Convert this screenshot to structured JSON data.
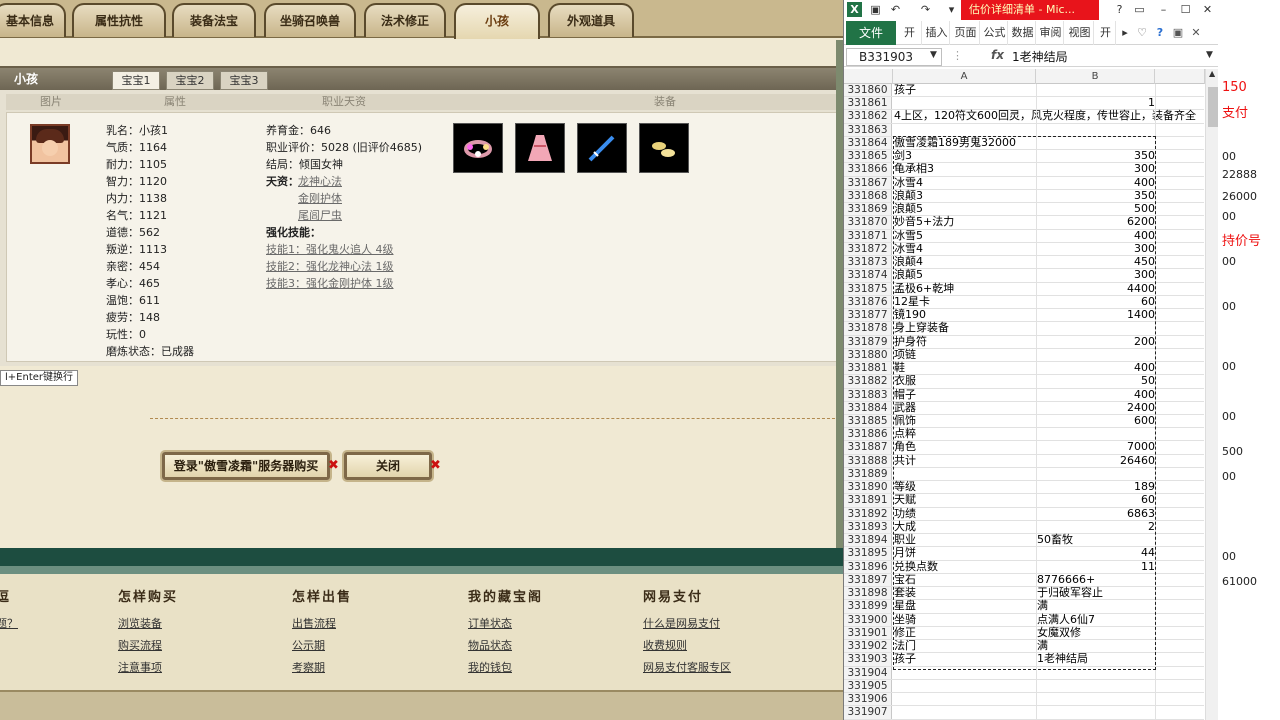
{
  "game": {
    "tabs": [
      "基本信息",
      "属性抗性",
      "装备法宝",
      "坐骑召唤兽",
      "法术修正",
      "小孩",
      "外观道具"
    ],
    "panel_title": "小孩",
    "baby_tabs": [
      "宝宝1",
      "宝宝2",
      "宝宝3"
    ],
    "col_headers": [
      "图片",
      "属性",
      "职业天资",
      "装备"
    ],
    "attrs": [
      "乳名：小孩1",
      "气质：1164",
      "耐力：1105",
      "智力：1120",
      "内力：1138",
      "名气：1121",
      "道德：562",
      "叛逆：1113",
      "亲密：454",
      "孝心：465",
      "温饱：611",
      "疲劳：148",
      "玩性：0",
      "磨炼状态：已成器"
    ],
    "career": {
      "fee": "养育金：646",
      "rating": "职业评价：5028 (旧评价4685)",
      "ending": "结局：倾国女神",
      "talent_label": "天资：",
      "talents": [
        "龙神心法",
        "金刚护体",
        "尾闾尸虫"
      ],
      "skill_label": "强化技能：",
      "skills": [
        "技能1：强化鬼火追人 4级",
        "技能2：强化龙神心法 1级",
        "技能3：强化金刚护体 1级"
      ]
    },
    "equip_icons": [
      "flower-wreath-icon",
      "pink-dress-icon",
      "blue-sword-icon",
      "golden-shoes-icon"
    ],
    "hint": "l+Enter键换行",
    "buy_button": "登录\"傲雪凌霜\"服务器购买",
    "close_button": "关闭",
    "footer": {
      "col0_head": "逗",
      "col0_links": [
        "题？"
      ],
      "col1_head": "怎样购买",
      "col1_links": [
        "浏览装备",
        "购买流程",
        "注意事项"
      ],
      "col2_head": "怎样出售",
      "col2_links": [
        "出售流程",
        "公示期",
        "考察期"
      ],
      "col3_head": "我的藏宝阁",
      "col3_links": [
        "订单状态",
        "物品状态",
        "我的钱包"
      ],
      "col4_head": "网易支付",
      "col4_links": [
        "什么是网易支付",
        "收费规则",
        "网易支付客服专区"
      ]
    }
  },
  "excel": {
    "doc_title": "估价详细清单 - Mic...",
    "file_tab": "文件",
    "ribbon_tabs": [
      "开",
      "插入",
      "页面",
      "公式",
      "数据",
      "审阅",
      "视图",
      "开发"
    ],
    "name_box": "B331903",
    "fx": "fx",
    "formula": "1老神结局",
    "col_a": "A",
    "col_b": "B",
    "rows": [
      {
        "n": "331860",
        "a": "孩子",
        "b": ""
      },
      {
        "n": "331861",
        "a": "",
        "b": "1"
      },
      {
        "n": "331862",
        "a": "4上区，120符文600回灵，风克火程度，传世容止，装备齐全",
        "b": ""
      },
      {
        "n": "331863",
        "a": "",
        "b": ""
      },
      {
        "n": "331864",
        "a": "傲雪凌霜189男鬼32000",
        "b": ""
      },
      {
        "n": "331865",
        "a": "剑3",
        "b": "350"
      },
      {
        "n": "331866",
        "a": "龟承相3",
        "b": "300"
      },
      {
        "n": "331867",
        "a": "冰雪4",
        "b": "400"
      },
      {
        "n": "331868",
        "a": "浪颠3",
        "b": "350"
      },
      {
        "n": "331869",
        "a": "浪颠5",
        "b": "500"
      },
      {
        "n": "331870",
        "a": "妙音5+法力",
        "b": "6200"
      },
      {
        "n": "331871",
        "a": "冰雪5",
        "b": "400"
      },
      {
        "n": "331872",
        "a": "冰雪4",
        "b": "300"
      },
      {
        "n": "331873",
        "a": "浪颠4",
        "b": "450"
      },
      {
        "n": "331874",
        "a": "浪颠5",
        "b": "300"
      },
      {
        "n": "331875",
        "a": "孟极6+乾坤",
        "b": "4400"
      },
      {
        "n": "331876",
        "a": "12星卡",
        "b": "60"
      },
      {
        "n": "331877",
        "a": "镜190",
        "b": "1400"
      },
      {
        "n": "331878",
        "a": "身上穿装备",
        "b": ""
      },
      {
        "n": "331879",
        "a": "护身符",
        "b": "200"
      },
      {
        "n": "331880",
        "a": "项链",
        "b": ""
      },
      {
        "n": "331881",
        "a": "鞋",
        "b": "400"
      },
      {
        "n": "331882",
        "a": "衣服",
        "b": "50"
      },
      {
        "n": "331883",
        "a": "帽子",
        "b": "400"
      },
      {
        "n": "331884",
        "a": "武器",
        "b": "2400"
      },
      {
        "n": "331885",
        "a": "佩饰",
        "b": "600"
      },
      {
        "n": "331886",
        "a": "点粹",
        "b": ""
      },
      {
        "n": "331887",
        "a": "角色",
        "b": "7000"
      },
      {
        "n": "331888",
        "a": "共计",
        "b": "26460"
      },
      {
        "n": "331889",
        "a": "",
        "b": ""
      },
      {
        "n": "331890",
        "a": "等级",
        "b": "189"
      },
      {
        "n": "331891",
        "a": "天赋",
        "b": "60"
      },
      {
        "n": "331892",
        "a": "功绩",
        "b": "6863"
      },
      {
        "n": "331893",
        "a": "大成",
        "b": "2"
      },
      {
        "n": "331894",
        "a": "职业",
        "b": "50畜牧",
        "text": true
      },
      {
        "n": "331895",
        "a": "月饼",
        "b": "44"
      },
      {
        "n": "331896",
        "a": "兑换点数",
        "b": "11"
      },
      {
        "n": "331897",
        "a": "宝石",
        "b": "8776666+",
        "text": true
      },
      {
        "n": "331898",
        "a": "套装",
        "b": "于归破军容止",
        "text": true
      },
      {
        "n": "331899",
        "a": "星盘",
        "b": "满",
        "text": true
      },
      {
        "n": "331900",
        "a": "坐骑",
        "b": "点满人6仙7",
        "text": true
      },
      {
        "n": "331901",
        "a": "修正",
        "b": "女魔双修",
        "text": true
      },
      {
        "n": "331902",
        "a": "法门",
        "b": "满",
        "text": true
      },
      {
        "n": "331903",
        "a": "孩子",
        "b": "1老神结局",
        "text": true
      },
      {
        "n": "331904",
        "a": "",
        "b": ""
      },
      {
        "n": "331905",
        "a": "",
        "b": ""
      },
      {
        "n": "331906",
        "a": "",
        "b": ""
      },
      {
        "n": "331907",
        "a": "",
        "b": ""
      }
    ]
  },
  "bgdoc": {
    "texts": [
      {
        "t": "150",
        "red": true
      },
      {
        "t": "支付",
        "red": true
      },
      {
        "t": "00",
        "red": false
      },
      {
        "t": "22888",
        "red": false
      },
      {
        "t": "26000",
        "red": false
      },
      {
        "t": "00",
        "red": false
      },
      {
        "t": "持价号",
        "red": true
      },
      {
        "t": "00",
        "red": false
      },
      {
        "t": "00",
        "red": false
      },
      {
        "t": "00",
        "red": false
      },
      {
        "t": "00",
        "red": false
      },
      {
        "t": "500",
        "red": false
      },
      {
        "t": "00",
        "red": false
      },
      {
        "t": "00",
        "red": false
      },
      {
        "t": "61000",
        "red": false
      }
    ]
  }
}
